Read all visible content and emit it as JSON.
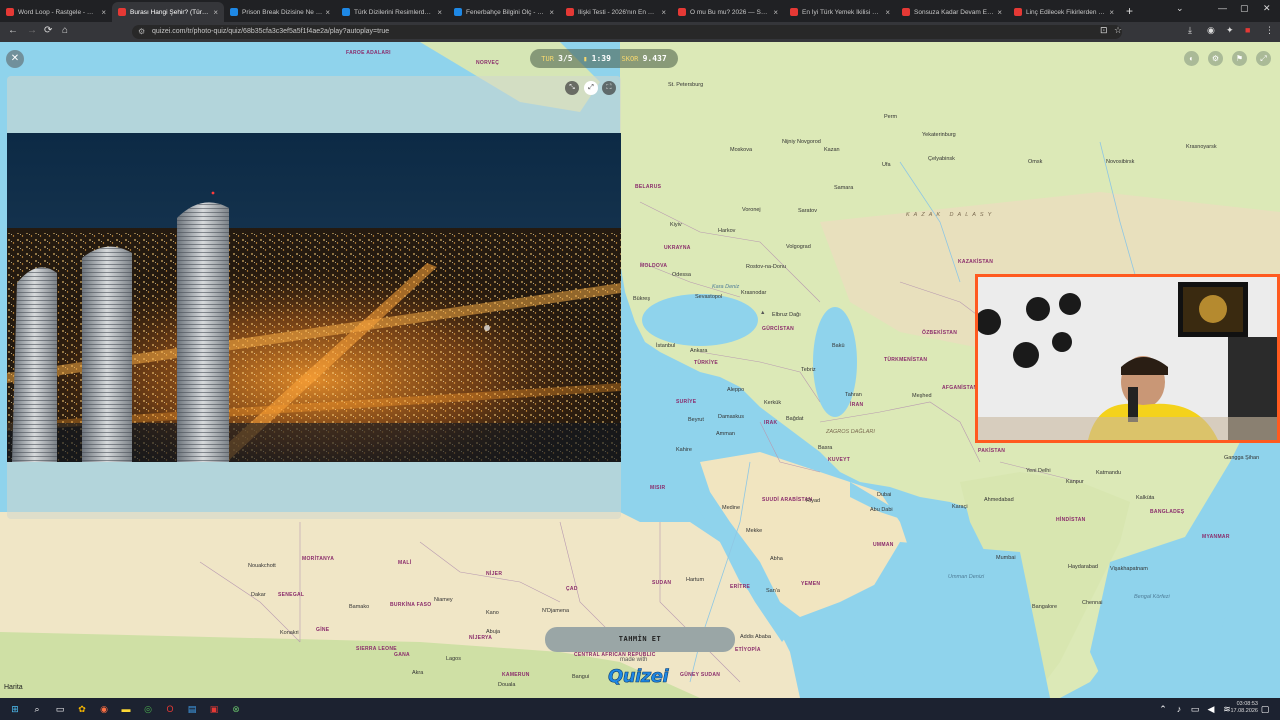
{
  "browser": {
    "tabs": [
      {
        "label": "Word Loop - Rastgele - Quizei",
        "color": "#e53935",
        "active": false
      },
      {
        "label": "Burası Hangi Şehir? (Türkiye) - Q",
        "color": "#e53935",
        "active": true
      },
      {
        "label": "Prison Break Dizisine Ne Kadar",
        "color": "#1e88e5",
        "active": false
      },
      {
        "label": "Türk Dizilerini Resimlerden Tahm",
        "color": "#1e88e5",
        "active": false
      },
      {
        "label": "Fenerbahçe Bilgini Ölç - Quizei",
        "color": "#1e88e5",
        "active": false
      },
      {
        "label": "İlişki Testi - 2026'nın En Viral Te",
        "color": "#e53935",
        "active": false
      },
      {
        "label": "O mu Bu mu? 2026 — Sevgilini",
        "color": "#e53935",
        "active": false
      },
      {
        "label": "En İyi Türk Yemek İkilisi Hangisi",
        "color": "#e53935",
        "active": false
      },
      {
        "label": "Sonsuza Kadar Devam Edecek İl",
        "color": "#e53935",
        "active": false
      },
      {
        "label": "Linç Edilecek Fikirlerden Hangi",
        "color": "#e53935",
        "active": false
      }
    ],
    "url": "quizei.com/tr/photo-quiz/quiz/68b35cfa3c3ef5a5f1f4ae2a/play?autoplay=true"
  },
  "hud": {
    "round_label": "TUR",
    "round_value": "3/5",
    "time_value": "1:39",
    "score_label": "SKOR",
    "score_value": "9.437"
  },
  "map": {
    "countries": [
      {
        "name": "FAROE ADALARI"
      },
      {
        "name": "NORVEÇ"
      },
      {
        "name": "BELARUS"
      },
      {
        "name": "UKRAYNA"
      },
      {
        "name": "MOLDOVA"
      },
      {
        "name": "KAZAKİSTAN"
      },
      {
        "name": "ÖZBEKİSTAN"
      },
      {
        "name": "TÜRKMENİSTAN"
      },
      {
        "name": "AFGANİSTAN"
      },
      {
        "name": "PAKİSTAN"
      },
      {
        "name": "HİNDİSTAN"
      },
      {
        "name": "BANGLADEŞ"
      },
      {
        "name": "MYANMAR"
      },
      {
        "name": "İRAN"
      },
      {
        "name": "IRAK"
      },
      {
        "name": "SURİYE"
      },
      {
        "name": "TÜRKİYE"
      },
      {
        "name": "GÜRCİSTAN"
      },
      {
        "name": "SUUDİ ARABİSTAN"
      },
      {
        "name": "KUVEYT"
      },
      {
        "name": "UMMAN"
      },
      {
        "name": "YEMEN"
      },
      {
        "name": "ERİTRE"
      },
      {
        "name": "ETİYOPİA"
      },
      {
        "name": "SUDAN"
      },
      {
        "name": "MISIR"
      },
      {
        "name": "ÇAD"
      },
      {
        "name": "NİJER"
      },
      {
        "name": "MALİ"
      },
      {
        "name": "MORİTANYA"
      },
      {
        "name": "SENEGAL"
      },
      {
        "name": "BURKİNA FASO"
      },
      {
        "name": "GİNE"
      },
      {
        "name": "NİJERYA"
      },
      {
        "name": "GANA"
      },
      {
        "name": "SIERRA LEONE"
      },
      {
        "name": "KAMERUN"
      },
      {
        "name": "CENTRAL AFRICAN REPUBLIC"
      },
      {
        "name": "GÜNEY SUDAN"
      }
    ],
    "cities": [
      {
        "name": "St. Petersburg"
      },
      {
        "name": "Moskova"
      },
      {
        "name": "Nijniy Novgorod"
      },
      {
        "name": "Kazan"
      },
      {
        "name": "Ufa"
      },
      {
        "name": "Perm"
      },
      {
        "name": "Yekaterinburg"
      },
      {
        "name": "Çelyabinsk"
      },
      {
        "name": "Omsk"
      },
      {
        "name": "Novosibirsk"
      },
      {
        "name": "Krasnoyarsk"
      },
      {
        "name": "Samara"
      },
      {
        "name": "Saratov"
      },
      {
        "name": "Voronej"
      },
      {
        "name": "Kiyiv"
      },
      {
        "name": "Harkov"
      },
      {
        "name": "Volgograd"
      },
      {
        "name": "Rostov-na-Donu"
      },
      {
        "name": "Odessa"
      },
      {
        "name": "Krasnodar"
      },
      {
        "name": "Sevastopol"
      },
      {
        "name": "Bükreş"
      },
      {
        "name": "İstanbul"
      },
      {
        "name": "Ankara"
      },
      {
        "name": "Elbruz Dağı"
      },
      {
        "name": "Bakü"
      },
      {
        "name": "Tebriz"
      },
      {
        "name": "Tahran"
      },
      {
        "name": "Meşhed"
      },
      {
        "name": "Aleppo"
      },
      {
        "name": "Beyrut"
      },
      {
        "name": "Damaskus"
      },
      {
        "name": "Amman"
      },
      {
        "name": "Kahire"
      },
      {
        "name": "Kerkük"
      },
      {
        "name": "Bağdat"
      },
      {
        "name": "Basra"
      },
      {
        "name": "Riyad"
      },
      {
        "name": "Dubai"
      },
      {
        "name": "Abu Dabi"
      },
      {
        "name": "Karaçi"
      },
      {
        "name": "Medine"
      },
      {
        "name": "Mekke"
      },
      {
        "name": "Abha"
      },
      {
        "name": "San'a"
      },
      {
        "name": "Hartum"
      },
      {
        "name": "Addis Ababa"
      },
      {
        "name": "Yeni Delhi"
      },
      {
        "name": "Kanpur"
      },
      {
        "name": "Ahmedabad"
      },
      {
        "name": "Mumbai"
      },
      {
        "name": "Haydarabad"
      },
      {
        "name": "Vişakhapatnam"
      },
      {
        "name": "Bangalore"
      },
      {
        "name": "Chennai"
      },
      {
        "name": "Kalküta"
      },
      {
        "name": "Katmandu"
      },
      {
        "name": "Gangga Şihan"
      },
      {
        "name": "Nouakchott"
      },
      {
        "name": "Dakar"
      },
      {
        "name": "Bamako"
      },
      {
        "name": "Niamey"
      },
      {
        "name": "Kano"
      },
      {
        "name": "N'Djamena"
      },
      {
        "name": "Konakri"
      },
      {
        "name": "Abuja"
      },
      {
        "name": "Lagos"
      },
      {
        "name": "Akra"
      },
      {
        "name": "Bangui"
      },
      {
        "name": "Douala"
      }
    ],
    "regions": [
      {
        "name": "KAZAK DALASY"
      },
      {
        "name": "Kara Deniz"
      },
      {
        "name": "Umman Denizi"
      },
      {
        "name": "Bengal Körfezi"
      },
      {
        "name": "ZAGROS DAĞLARI"
      }
    ]
  },
  "controls": {
    "close_icon": "close-icon",
    "guess_button": "TAHMİN ET",
    "made_with": "made with",
    "logo": "Quizei",
    "harita": "Harita"
  },
  "clock": {
    "time": "03:08:53",
    "date": "17.08.2026"
  }
}
